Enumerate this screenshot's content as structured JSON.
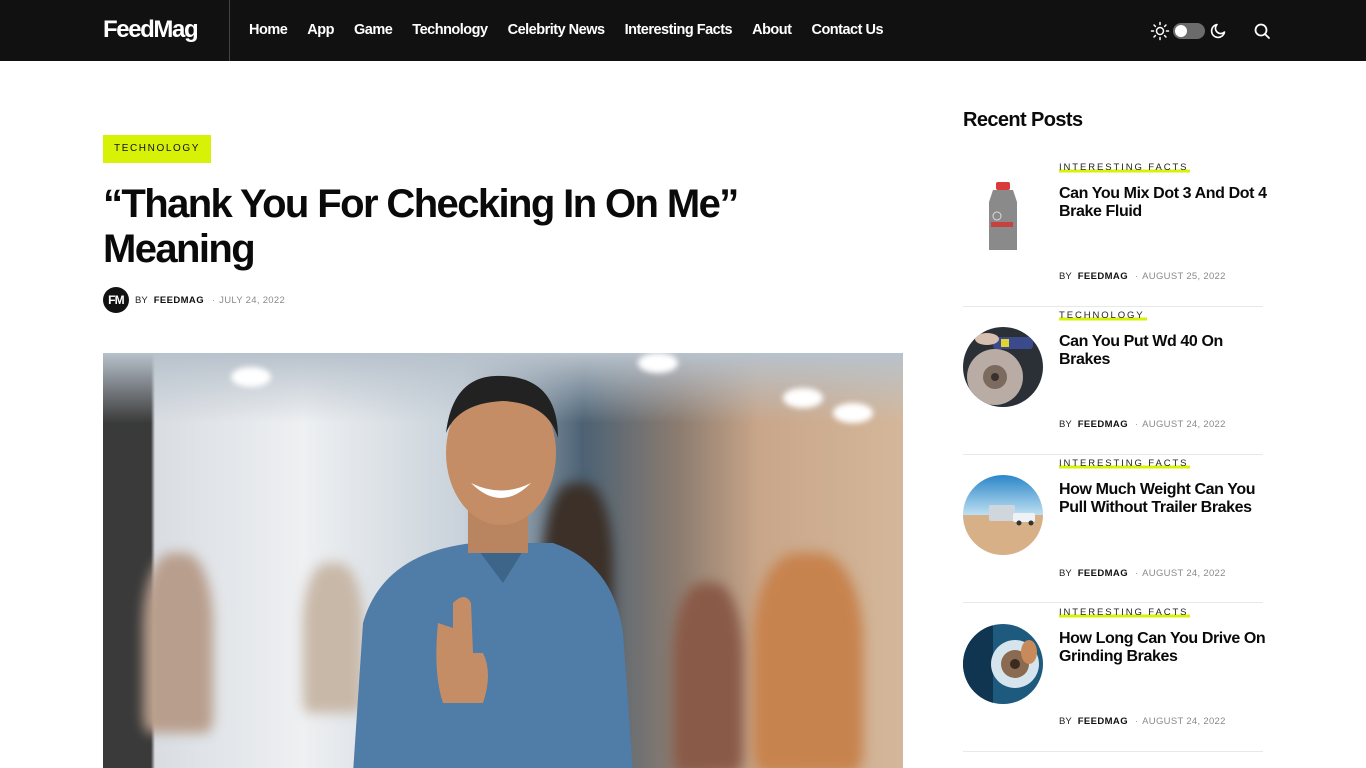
{
  "header": {
    "logo": "FeedMag",
    "nav": [
      "Home",
      "App",
      "Game",
      "Technology",
      "Celebrity News",
      "Interesting Facts",
      "About",
      "Contact Us"
    ],
    "icons": {
      "theme_light": "sun-icon",
      "theme_toggle": "toggle-switch",
      "theme_dark": "moon-icon",
      "search": "search-icon"
    },
    "theme_toggle_state": "light"
  },
  "article": {
    "category": "TECHNOLOGY",
    "title": "“Thank You For Checking In On Me” Meaning",
    "avatar_initials": "FM",
    "by_label": "BY",
    "author": "FEEDMAG",
    "separator": "·",
    "date": "JULY 24, 2022",
    "featured_image_alt": "Smiling man in denim shirt giving thumbs up in office"
  },
  "sidebar": {
    "title": "Recent Posts",
    "posts": [
      {
        "category": "INTERESTING FACTS",
        "title": "Can You Mix Dot 3 And Dot 4 Brake Fluid",
        "by_label": "BY",
        "author": "FEEDMAG",
        "separator": "·",
        "date": "AUGUST 25, 2022",
        "thumb": "brake-fluid-bottle"
      },
      {
        "category": "TECHNOLOGY",
        "title": "Can You Put Wd 40 On Brakes",
        "by_label": "BY",
        "author": "FEEDMAG",
        "separator": "·",
        "date": "AUGUST 24, 2022",
        "thumb": "brake-disc-spray"
      },
      {
        "category": "INTERESTING FACTS",
        "title": "How Much Weight Can You Pull Without Trailer Brakes",
        "by_label": "BY",
        "author": "FEEDMAG",
        "separator": "·",
        "date": "AUGUST 24, 2022",
        "thumb": "truck-trailer-desert"
      },
      {
        "category": "INTERESTING FACTS",
        "title": "How Long Can You Drive On Grinding Brakes",
        "by_label": "BY",
        "author": "FEEDMAG",
        "separator": "·",
        "date": "AUGUST 24, 2022",
        "thumb": "brake-caliper-blue"
      }
    ]
  },
  "colors": {
    "header_bg": "#111111",
    "accent": "#d7f207",
    "text": "#0a0a0a",
    "muted": "#8a8a8a"
  }
}
